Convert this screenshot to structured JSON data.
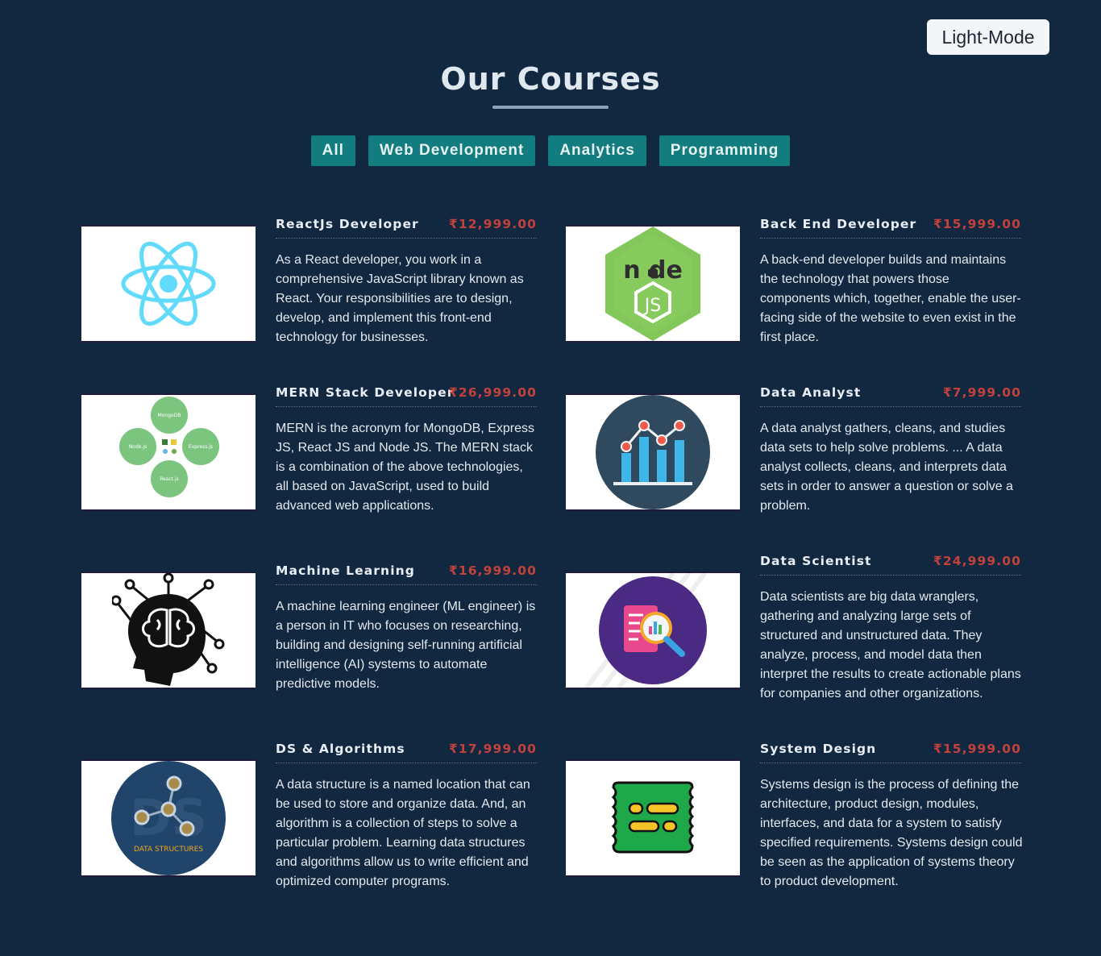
{
  "mode_toggle": {
    "label": "Light-Mode"
  },
  "page": {
    "title": "Our Courses"
  },
  "filters": [
    {
      "label": "All"
    },
    {
      "label": "Web Development"
    },
    {
      "label": "Analytics"
    },
    {
      "label": "Programming"
    }
  ],
  "courses": [
    {
      "name": "ReactJs Developer",
      "price": "₹12,999.00",
      "description": "As a React developer, you work in a comprehensive JavaScript library known as React. Your responsibilities are to design, develop, and implement this front-end technology for businesses.",
      "image": "react-logo"
    },
    {
      "name": "Back End Developer",
      "price": "₹15,999.00",
      "description": "A back-end developer builds and maintains the technology that powers those components which, together, enable the user-facing side of the website to even exist in the first place.",
      "image": "nodejs-logo"
    },
    {
      "name": "MERN Stack Developer",
      "price": "₹26,999.00",
      "description": "MERN is the acronym for MongoDB, Express JS, React JS and Node JS. The MERN stack is a combination of the above technologies, all based on JavaScript, used to build advanced web applications.",
      "image": "mern-diagram",
      "diagram_labels": [
        "MongoDB",
        "Node.js",
        "Express.js",
        "React.js"
      ]
    },
    {
      "name": "Data Analyst",
      "price": "₹7,999.00",
      "description": "A data analyst gathers, cleans, and studies data sets to help solve problems. ... A data analyst collects, cleans, and interprets data sets in order to answer a question or solve a problem.",
      "image": "analytics-chart-icon"
    },
    {
      "name": "Machine Learning",
      "price": "₹16,999.00",
      "description": "A machine learning engineer (ML engineer) is a person in IT who focuses on researching, building and designing self-running artificial intelligence (AI) systems to automate predictive models.",
      "image": "brain-head-icon"
    },
    {
      "name": "Data Scientist",
      "price": "₹24,999.00",
      "description": "Data scientists are big data wranglers, gathering and analyzing large sets of structured and unstructured data. They analyze, process, and model data then interpret the results to create actionable plans for companies and other organizations.",
      "image": "data-search-icon"
    },
    {
      "name": "DS & Algorithms",
      "price": "₹17,999.00",
      "description": "A data structure is a named location that can be used to store and organize data. And, an algorithm is a collection of steps to solve a particular problem. Learning data structures and algorithms allow us to write efficient and optimized computer programs.",
      "image": "data-structures-icon",
      "image_caption": "DATA STRUCTURES"
    },
    {
      "name": "System Design",
      "price": "₹15,999.00",
      "description": "Systems design is the process of defining the architecture, product design, modules, interfaces, and data for a system to satisfy specified requirements. Systems design could be seen as the application of systems theory to product development.",
      "image": "database-stack-icon"
    }
  ],
  "colors": {
    "background": "#112840",
    "filter_button": "#127c7f",
    "price": "#c2413b",
    "mode_button": "#f3f5f8"
  }
}
